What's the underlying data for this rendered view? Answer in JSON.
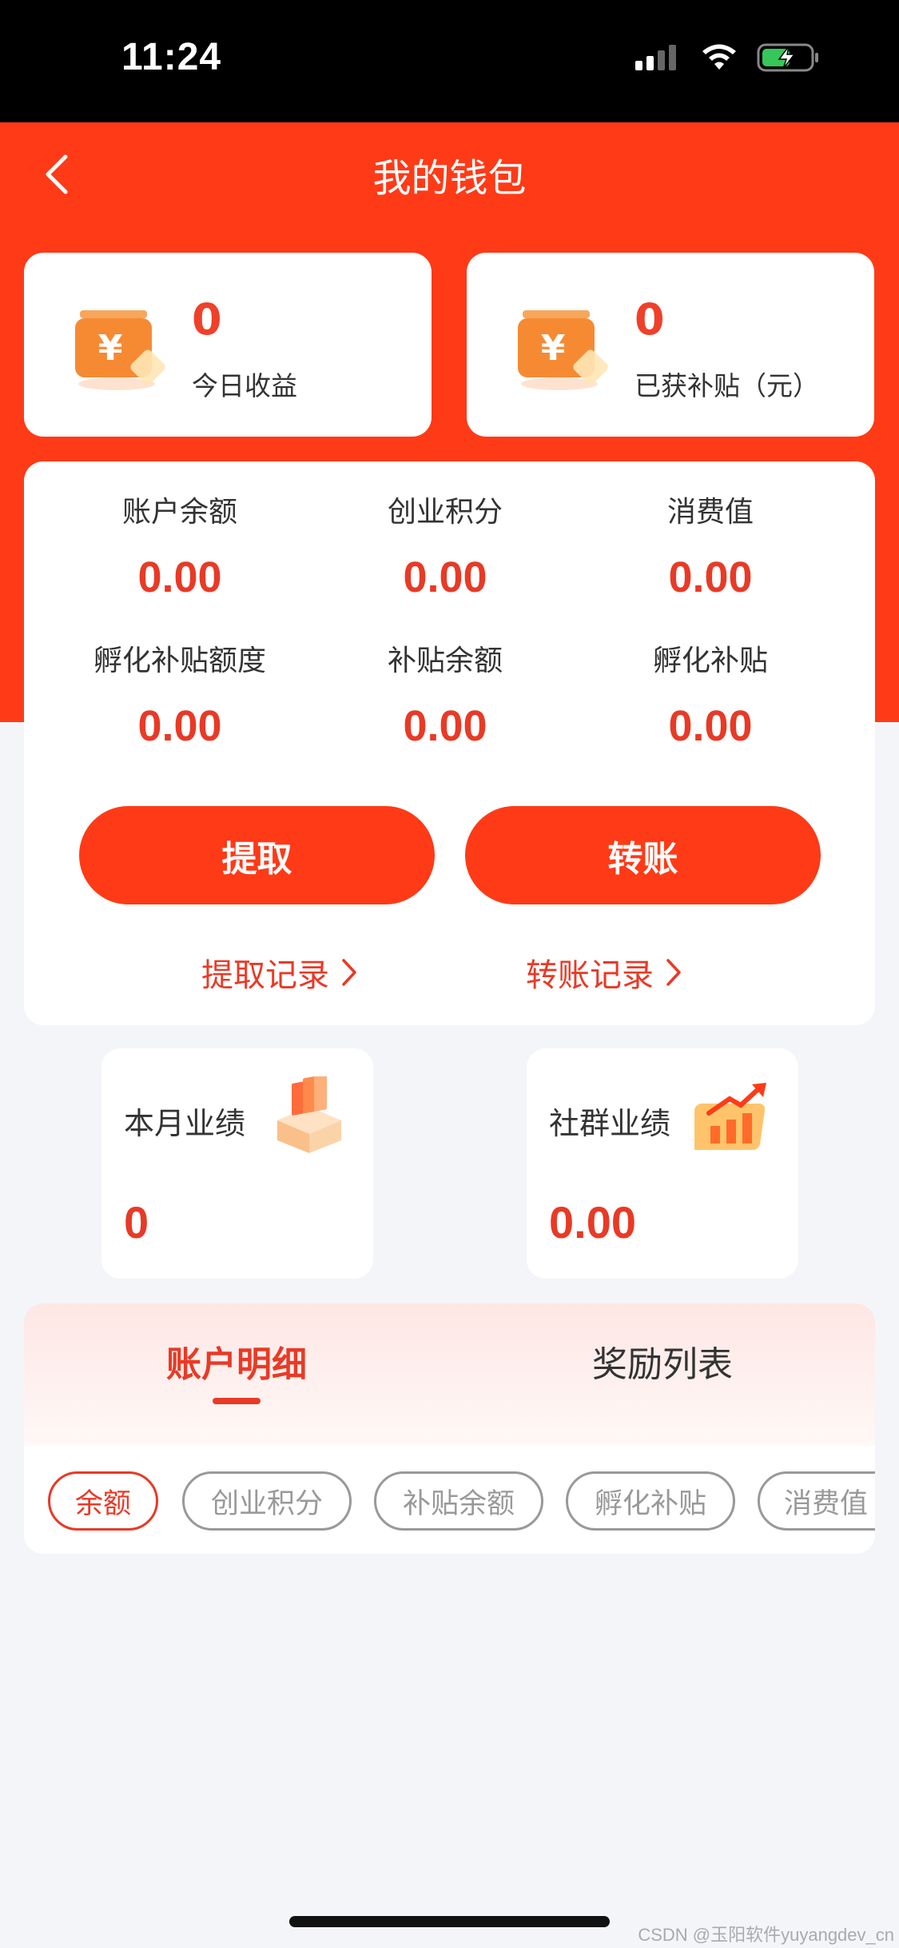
{
  "status_bar": {
    "time": "11:24"
  },
  "nav": {
    "title": "我的钱包"
  },
  "summary": [
    {
      "value": "0",
      "label": "今日收益"
    },
    {
      "value": "0",
      "label": "已获补贴（元）"
    }
  ],
  "stats": [
    {
      "label": "账户余额",
      "value": "0.00"
    },
    {
      "label": "创业积分",
      "value": "0.00"
    },
    {
      "label": "消费值",
      "value": "0.00"
    },
    {
      "label": "孵化补贴额度",
      "value": "0.00"
    },
    {
      "label": "补贴余额",
      "value": "0.00"
    },
    {
      "label": "孵化补贴",
      "value": "0.00"
    }
  ],
  "actions": {
    "withdraw": "提取",
    "transfer": "转账"
  },
  "records": {
    "withdraw": "提取记录",
    "transfer": "转账记录"
  },
  "performance": [
    {
      "label": "本月业绩",
      "value": "0"
    },
    {
      "label": "社群业绩",
      "value": "0.00"
    }
  ],
  "tabs": [
    {
      "label": "账户明细",
      "active": true
    },
    {
      "label": "奖励列表",
      "active": false
    }
  ],
  "chips": [
    {
      "label": "余额",
      "active": true
    },
    {
      "label": "创业积分",
      "active": false
    },
    {
      "label": "补贴余额",
      "active": false
    },
    {
      "label": "孵化补贴",
      "active": false
    },
    {
      "label": "消费值",
      "active": false
    }
  ],
  "watermark": "CSDN @玉阳软件yuyangdev_cn",
  "colors": {
    "primary": "#ff3a17",
    "value_red": "#e83a26",
    "background": "#f4f5f9"
  }
}
